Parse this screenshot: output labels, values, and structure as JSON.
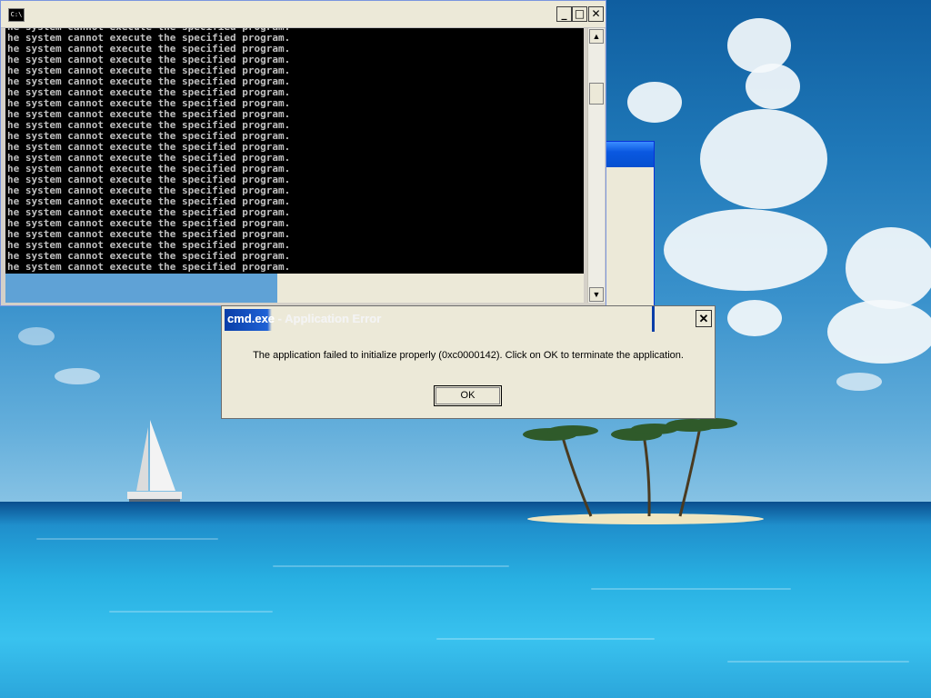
{
  "console": {
    "icon_label": "C:\\",
    "line_text": "he system cannot execute the specified program.",
    "visible_line_count": 23,
    "buttons": {
      "minimize": "_",
      "maximize": "□",
      "close": "✕"
    }
  },
  "error_dialog": {
    "title_prefix": "cmd.exe",
    "title_rest": " - Application Error",
    "message": "The application failed to initialize properly (0xc0000142). Click on OK to terminate the application.",
    "ok_label": "OK",
    "close_glyph": "✕"
  }
}
